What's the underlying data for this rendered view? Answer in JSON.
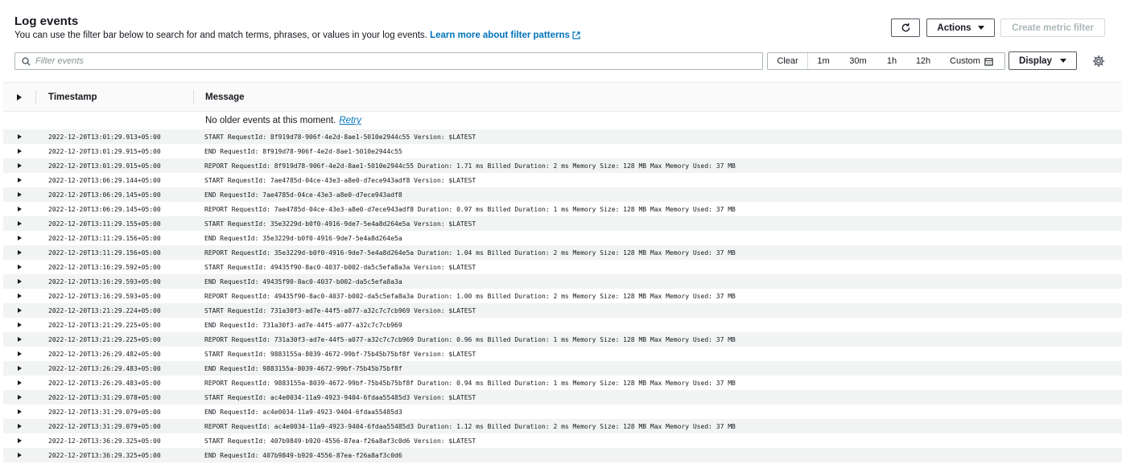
{
  "header": {
    "title": "Log events",
    "description": "You can use the filter bar below to search for and match terms, phrases, or values in your log events.",
    "learn_more": "Learn more about filter patterns"
  },
  "toolbar": {
    "actions_label": "Actions",
    "create_metric_label": "Create metric filter",
    "display_label": "Display"
  },
  "search": {
    "placeholder": "Filter events"
  },
  "time_range": {
    "clear": "Clear",
    "options": [
      "1m",
      "30m",
      "1h",
      "12h"
    ],
    "custom": "Custom"
  },
  "table": {
    "columns": {
      "timestamp": "Timestamp",
      "message": "Message"
    },
    "no_older": "No older events at this moment.",
    "retry": "Retry",
    "rows": [
      {
        "ts": "2022-12-20T13:01:29.913+05:00",
        "msg": "START RequestId: 8f919d78-906f-4e2d-8ae1-5010e2944c55 Version: $LATEST"
      },
      {
        "ts": "2022-12-20T13:01:29.915+05:00",
        "msg": "END RequestId: 8f919d78-906f-4e2d-8ae1-5010e2944c55"
      },
      {
        "ts": "2022-12-20T13:01:29.915+05:00",
        "msg": "REPORT RequestId: 8f919d78-906f-4e2d-8ae1-5010e2944c55 Duration: 1.71 ms Billed Duration: 2 ms Memory Size: 128 MB Max Memory Used: 37 MB"
      },
      {
        "ts": "2022-12-20T13:06:29.144+05:00",
        "msg": "START RequestId: 7ae4785d-04ce-43e3-a8e0-d7ece943adf8 Version: $LATEST"
      },
      {
        "ts": "2022-12-20T13:06:29.145+05:00",
        "msg": "END RequestId: 7ae4785d-04ce-43e3-a8e0-d7ece943adf8"
      },
      {
        "ts": "2022-12-20T13:06:29.145+05:00",
        "msg": "REPORT RequestId: 7ae4785d-04ce-43e3-a8e0-d7ece943adf8 Duration: 0.97 ms Billed Duration: 1 ms Memory Size: 128 MB Max Memory Used: 37 MB"
      },
      {
        "ts": "2022-12-20T13:11:29.155+05:00",
        "msg": "START RequestId: 35e3229d-b0f0-4916-9de7-5e4a8d264e5a Version: $LATEST"
      },
      {
        "ts": "2022-12-20T13:11:29.156+05:00",
        "msg": "END RequestId: 35e3229d-b0f0-4916-9de7-5e4a8d264e5a"
      },
      {
        "ts": "2022-12-20T13:11:29.156+05:00",
        "msg": "REPORT RequestId: 35e3229d-b0f0-4916-9de7-5e4a8d264e5a Duration: 1.04 ms Billed Duration: 2 ms Memory Size: 128 MB Max Memory Used: 37 MB"
      },
      {
        "ts": "2022-12-20T13:16:29.592+05:00",
        "msg": "START RequestId: 49435f90-8ac0-4037-b002-da5c5efa8a3a Version: $LATEST"
      },
      {
        "ts": "2022-12-20T13:16:29.593+05:00",
        "msg": "END RequestId: 49435f90-8ac0-4037-b002-da5c5efa8a3a"
      },
      {
        "ts": "2022-12-20T13:16:29.593+05:00",
        "msg": "REPORT RequestId: 49435f90-8ac0-4037-b002-da5c5efa8a3a Duration: 1.00 ms Billed Duration: 2 ms Memory Size: 128 MB Max Memory Used: 37 MB"
      },
      {
        "ts": "2022-12-20T13:21:29.224+05:00",
        "msg": "START RequestId: 731a30f3-ad7e-44f5-a077-a32c7c7cb969 Version: $LATEST"
      },
      {
        "ts": "2022-12-20T13:21:29.225+05:00",
        "msg": "END RequestId: 731a30f3-ad7e-44f5-a077-a32c7c7cb969"
      },
      {
        "ts": "2022-12-20T13:21:29.225+05:00",
        "msg": "REPORT RequestId: 731a30f3-ad7e-44f5-a077-a32c7c7cb969 Duration: 0.96 ms Billed Duration: 1 ms Memory Size: 128 MB Max Memory Used: 37 MB"
      },
      {
        "ts": "2022-12-20T13:26:29.482+05:00",
        "msg": "START RequestId: 9883155a-8039-4672-99bf-75b45b75bf8f Version: $LATEST"
      },
      {
        "ts": "2022-12-20T13:26:29.483+05:00",
        "msg": "END RequestId: 9883155a-8039-4672-99bf-75b45b75bf8f"
      },
      {
        "ts": "2022-12-20T13:26:29.483+05:00",
        "msg": "REPORT RequestId: 9883155a-8039-4672-99bf-75b45b75bf8f Duration: 0.94 ms Billed Duration: 1 ms Memory Size: 128 MB Max Memory Used: 37 MB"
      },
      {
        "ts": "2022-12-20T13:31:29.078+05:00",
        "msg": "START RequestId: ac4e0034-11a9-4923-9404-6fdaa55485d3 Version: $LATEST"
      },
      {
        "ts": "2022-12-20T13:31:29.079+05:00",
        "msg": "END RequestId: ac4e0034-11a9-4923-9404-6fdaa55485d3"
      },
      {
        "ts": "2022-12-20T13:31:29.079+05:00",
        "msg": "REPORT RequestId: ac4e0034-11a9-4923-9404-6fdaa55485d3 Duration: 1.12 ms Billed Duration: 2 ms Memory Size: 128 MB Max Memory Used: 37 MB"
      },
      {
        "ts": "2022-12-20T13:36:29.325+05:00",
        "msg": "START RequestId: 407b9849-b920-4556-87ea-f26a8af3c0d6 Version: $LATEST"
      },
      {
        "ts": "2022-12-20T13:36:29.325+05:00",
        "msg": "END RequestId: 407b9849-b920-4556-87ea-f26a8af3c0d6"
      }
    ]
  },
  "colors": {
    "link": "#0073bb",
    "border": "#aab7b8",
    "row_alt": "#f2f3f3",
    "disabled": "#aab7b8"
  }
}
